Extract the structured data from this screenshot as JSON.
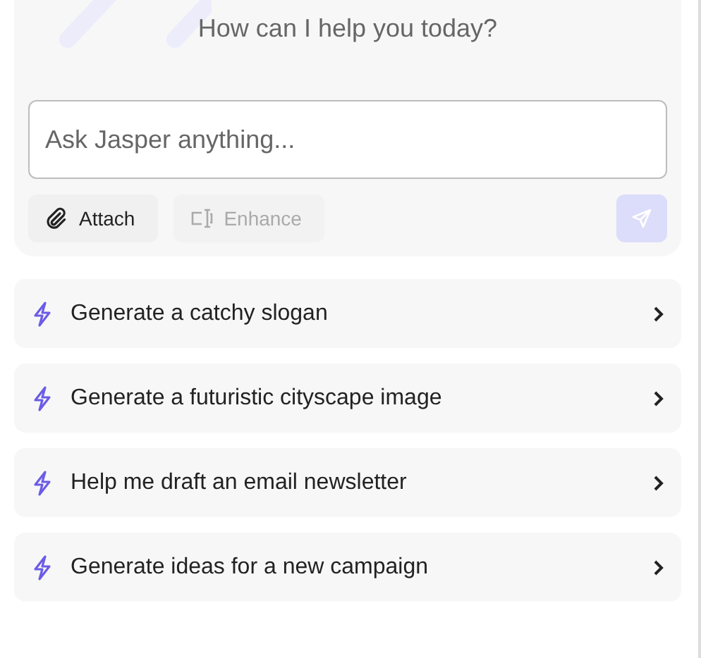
{
  "composer": {
    "greeting": "How can I help you today?",
    "input": {
      "placeholder": "Ask Jasper anything..."
    },
    "tools": [
      {
        "kind": "attach",
        "label": "Attach",
        "disabled": false
      },
      {
        "kind": "enhance",
        "label": "Enhance",
        "disabled": true
      }
    ],
    "send": {
      "disabled": true
    }
  },
  "suggestions": [
    {
      "label": "Generate a catchy slogan"
    },
    {
      "label": "Generate a futuristic cityscape image"
    },
    {
      "label": "Help me draft an email newsletter"
    },
    {
      "label": "Generate ideas for a new campaign"
    }
  ]
}
